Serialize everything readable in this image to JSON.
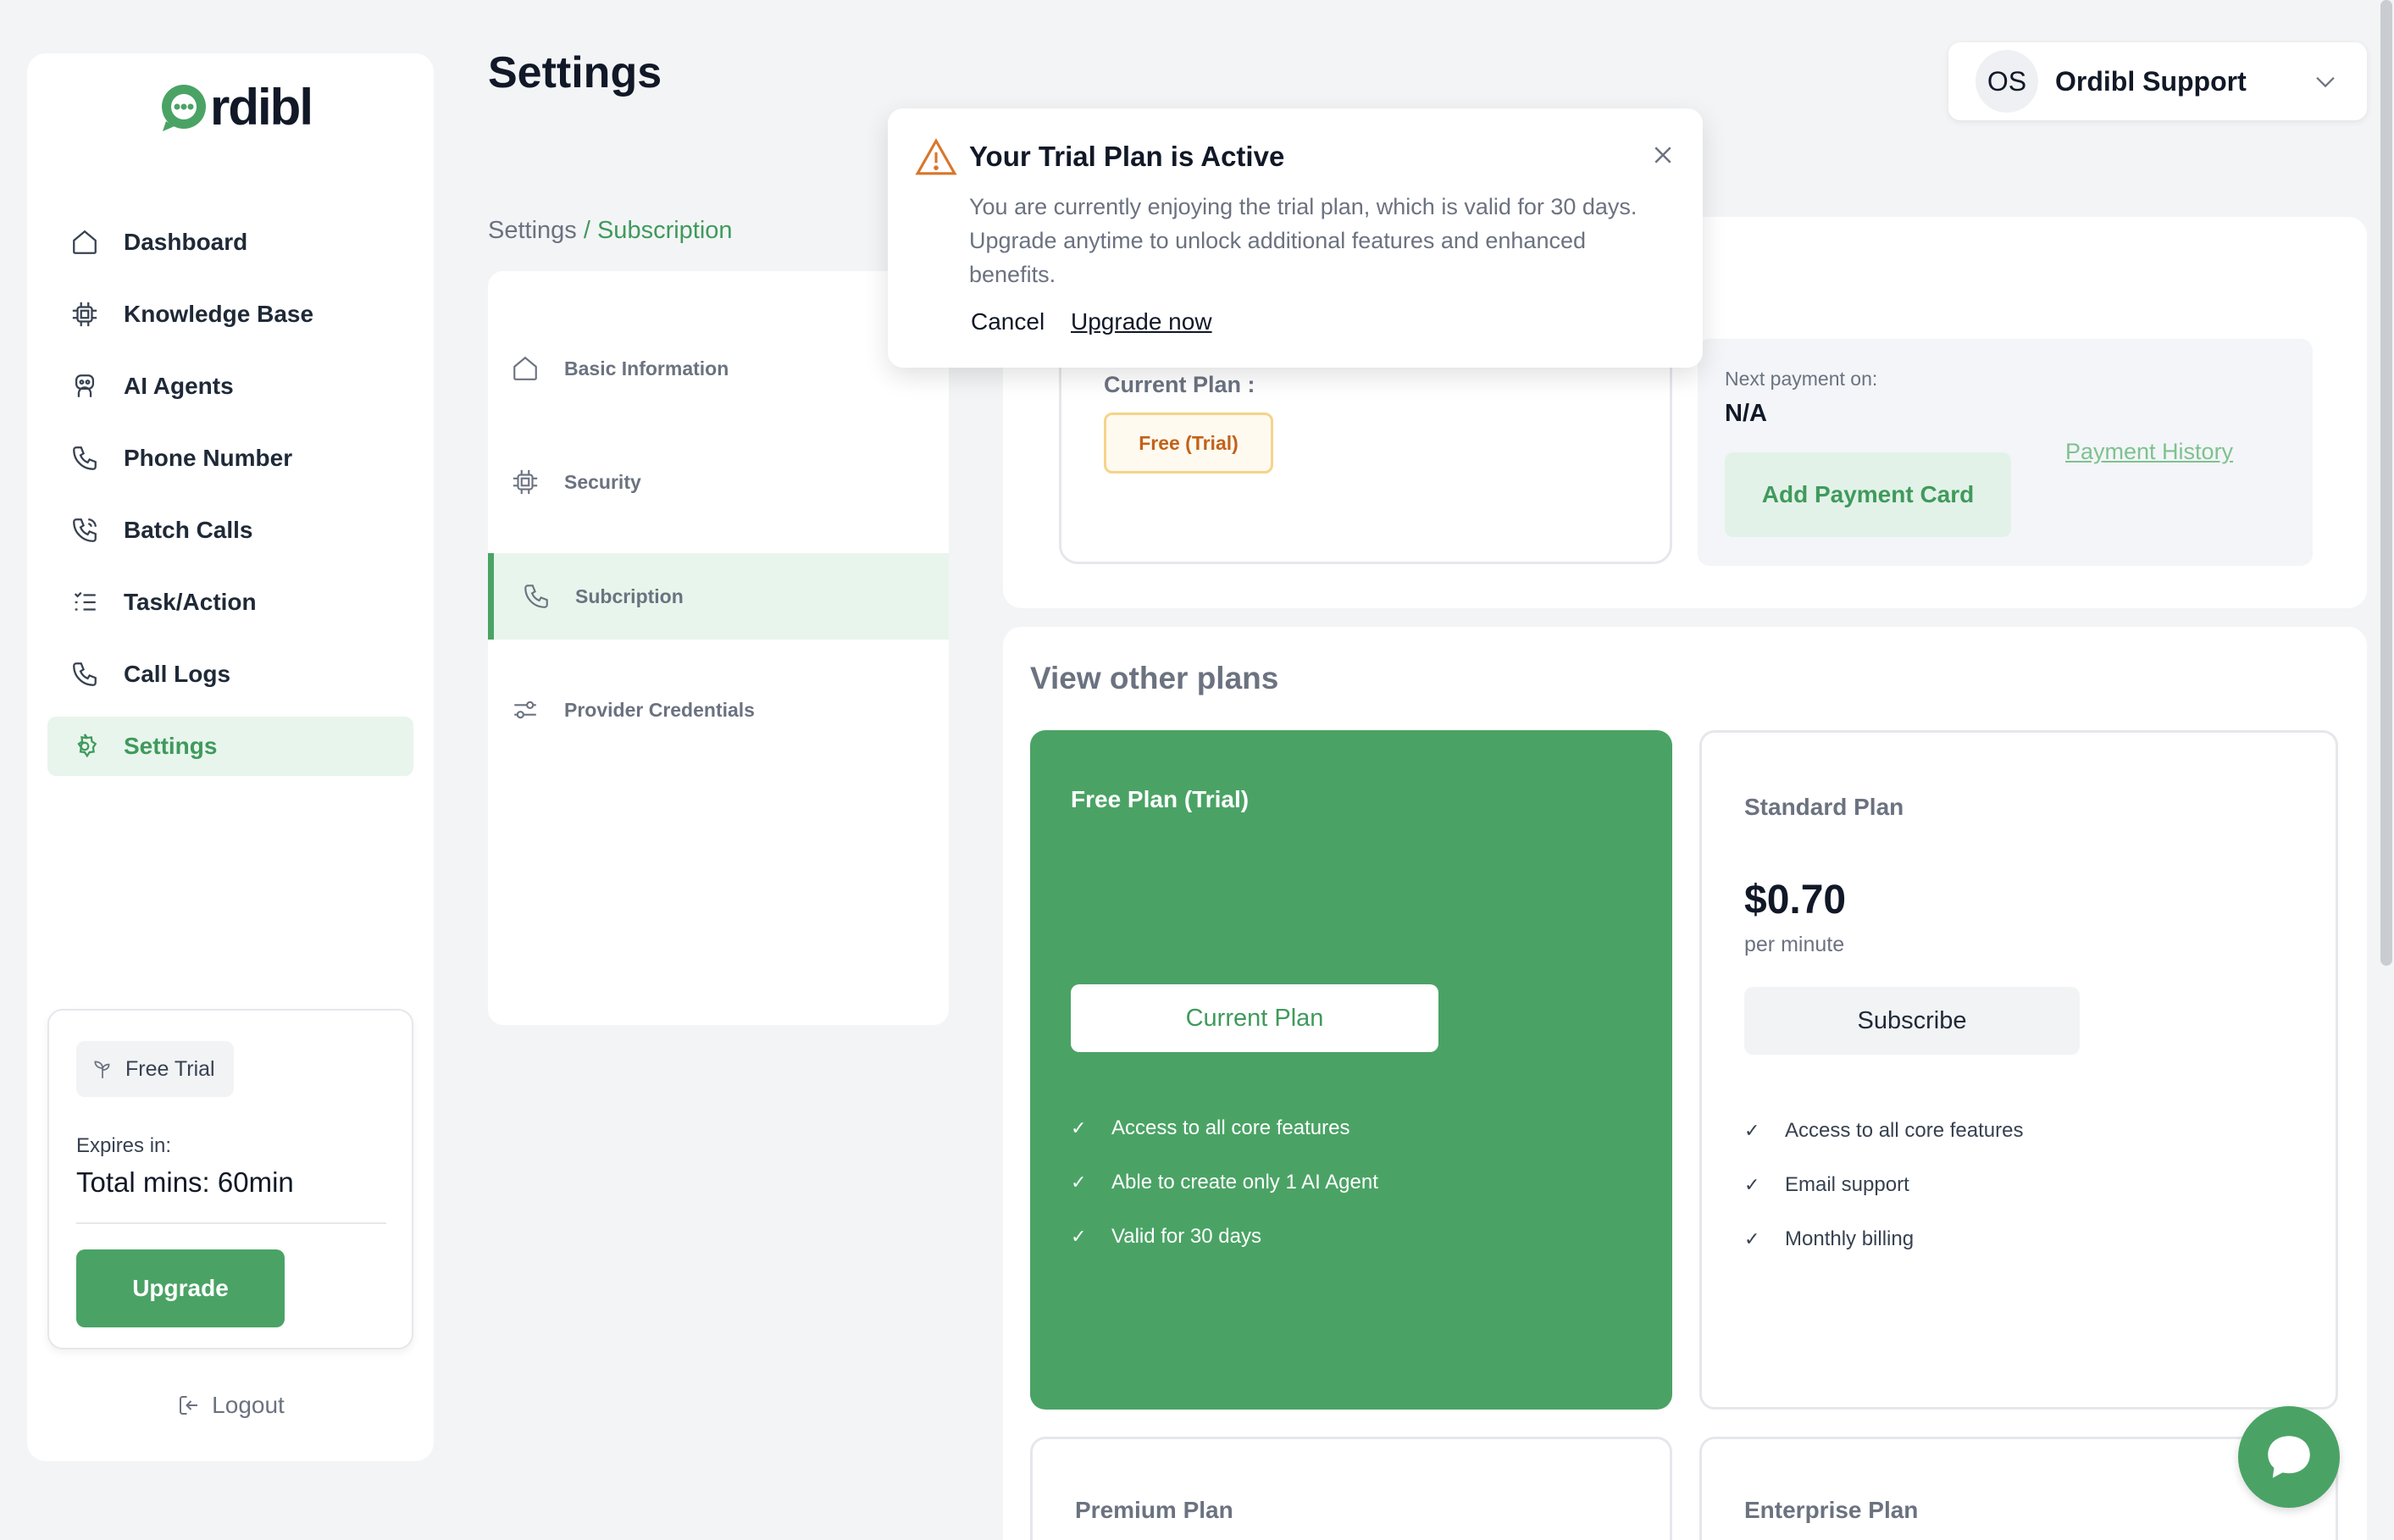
{
  "brand": {
    "logo_text": "rdibl",
    "accent": "#4aa365"
  },
  "sidebar": {
    "items": [
      {
        "label": "Dashboard",
        "icon": "home-icon"
      },
      {
        "label": "Knowledge Base",
        "icon": "chip-icon"
      },
      {
        "label": "AI Agents",
        "icon": "robot-icon"
      },
      {
        "label": "Phone Number",
        "icon": "phone-icon"
      },
      {
        "label": "Batch Calls",
        "icon": "phone-ring-icon"
      },
      {
        "label": "Task/Action",
        "icon": "list-icon"
      },
      {
        "label": "Call Logs",
        "icon": "phone-icon"
      },
      {
        "label": "Settings",
        "icon": "gear-icon",
        "active": true
      }
    ],
    "trial": {
      "badge": "Free Trial",
      "expires_label": "Expires in:",
      "total": "Total mins: 60min",
      "upgrade": "Upgrade"
    },
    "logout": "Logout"
  },
  "header": {
    "title": "Settings",
    "user_initials": "OS",
    "user_name": "Ordibl Support"
  },
  "breadcrumb": {
    "root": "Settings",
    "sep": " / ",
    "current": "Subscription"
  },
  "subnav": {
    "items": [
      {
        "label": "Basic Information",
        "icon": "home-icon"
      },
      {
        "label": "Security",
        "icon": "chip-icon"
      },
      {
        "label": "Subcription",
        "icon": "phone-icon",
        "active": true
      },
      {
        "label": "Provider Credentials",
        "icon": "sliders-icon"
      }
    ]
  },
  "subscription": {
    "current_plan_label": "Current Plan :",
    "current_plan_badge": "Free (Trial)",
    "next_payment_label": "Next payment on:",
    "next_payment_value": "N/A",
    "add_payment_card": "Add Payment Card",
    "payment_history": "Payment History"
  },
  "plans": {
    "title": "View other plans",
    "free": {
      "name": "Free Plan (Trial)",
      "button": "Current Plan",
      "features": [
        "Access to all core features",
        "Able to create only 1 AI Agent",
        "Valid for 30 days"
      ]
    },
    "standard": {
      "name": "Standard Plan",
      "price": "$0.70",
      "per": "per minute",
      "button": "Subscribe",
      "features": [
        "Access to all core features",
        "Email support",
        "Monthly billing"
      ]
    },
    "premium": {
      "name": "Premium Plan"
    },
    "enterprise": {
      "name": "Enterprise Plan"
    }
  },
  "modal": {
    "title": "Your Trial Plan is Active",
    "body": "You are currently enjoying the trial plan, which is valid for 30 days. Upgrade anytime to unlock additional features and enhanced benefits.",
    "cancel": "Cancel",
    "upgrade": "Upgrade now"
  }
}
